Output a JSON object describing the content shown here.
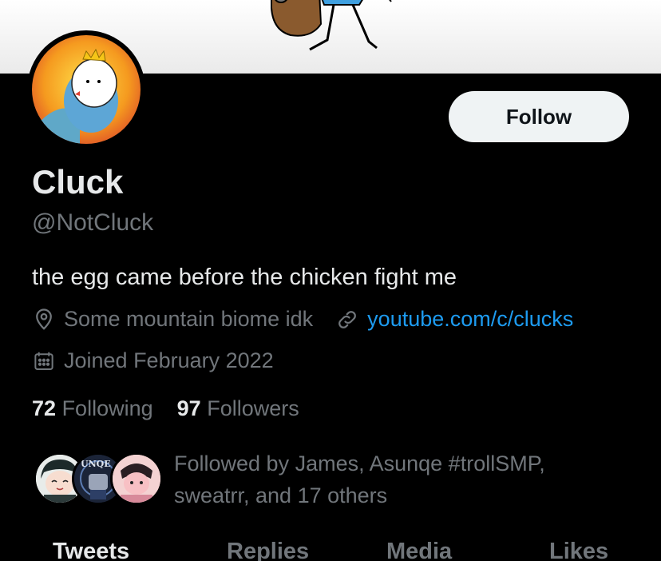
{
  "profile": {
    "name": "Cluck",
    "handle": "@NotCluck",
    "bio": "the egg came before the chicken fight me",
    "location": "Some mountain biome idk",
    "website": "youtube.com/c/clucks",
    "joined": "Joined February 2022"
  },
  "actions": {
    "follow_label": "Follow"
  },
  "stats": {
    "following_count": "72",
    "following_label": "Following",
    "followers_count": "97",
    "followers_label": "Followers"
  },
  "followed_by": {
    "text_line1": "Followed by James, Asunqe #trollSMP,",
    "text_line2": "sweatrr, and 17 others",
    "avatar2_text": "UNQE"
  },
  "tabs": [
    {
      "label": "Tweets",
      "active": true
    },
    {
      "label": "Replies",
      "active": false
    },
    {
      "label": "Media",
      "active": false
    },
    {
      "label": "Likes",
      "active": false
    }
  ],
  "icons": {
    "location": "map-pin-icon",
    "website": "link-icon",
    "joined": "calendar-icon"
  },
  "colors": {
    "background": "#000000",
    "primary_text": "#e7e9ea",
    "secondary_text": "#71767b",
    "link": "#1d9bf0",
    "follow_button_bg": "#eff3f4"
  }
}
